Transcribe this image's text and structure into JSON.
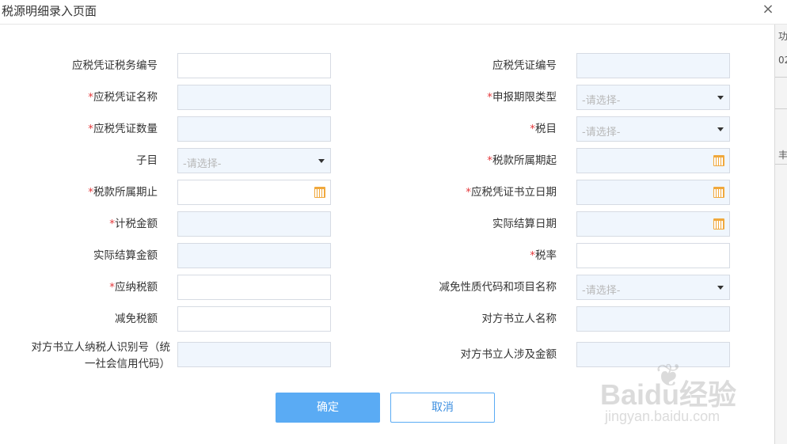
{
  "dialog": {
    "title": "税源明细录入页面",
    "close_glyph": "×"
  },
  "form": {
    "required_mark": "*",
    "left": [
      {
        "label": "应税凭证税务编号",
        "required": false,
        "type": "text",
        "value": ""
      },
      {
        "label": "应税凭证名称",
        "required": true,
        "type": "text-filled",
        "value": ""
      },
      {
        "label": "应税凭证数量",
        "required": true,
        "type": "text-filled",
        "value": ""
      },
      {
        "label": "子目",
        "required": false,
        "type": "select",
        "placeholder": "-请选择-"
      },
      {
        "label": "税款所属期止",
        "required": true,
        "type": "date",
        "value": ""
      },
      {
        "label": "计税金额",
        "required": true,
        "type": "text-filled",
        "value": ""
      },
      {
        "label": "实际结算金额",
        "required": false,
        "type": "text-filled",
        "value": ""
      },
      {
        "label": "应纳税额",
        "required": true,
        "type": "text",
        "value": ""
      },
      {
        "label": "减免税额",
        "required": false,
        "type": "text",
        "value": ""
      },
      {
        "label": "对方书立人纳税人识别号（统一社会信用代码）",
        "required": false,
        "type": "text-filled",
        "value": ""
      }
    ],
    "right": [
      {
        "label": "应税凭证编号",
        "required": false,
        "type": "text-filled",
        "value": ""
      },
      {
        "label": "申报期限类型",
        "required": true,
        "type": "select",
        "placeholder": "-请选择-"
      },
      {
        "label": "税目",
        "required": true,
        "type": "select",
        "placeholder": "-请选择-"
      },
      {
        "label": "税款所属期起",
        "required": true,
        "type": "date-filled",
        "value": ""
      },
      {
        "label": "应税凭证书立日期",
        "required": true,
        "type": "date-filled",
        "value": ""
      },
      {
        "label": "实际结算日期",
        "required": false,
        "type": "date-filled",
        "value": ""
      },
      {
        "label": "税率",
        "required": true,
        "type": "text",
        "value": ""
      },
      {
        "label": "减免性质代码和项目名称",
        "required": false,
        "type": "select",
        "placeholder": "-请选择-"
      },
      {
        "label": "对方书立人名称",
        "required": false,
        "type": "text-filled",
        "value": ""
      },
      {
        "label": "对方书立人涉及金额",
        "required": false,
        "type": "text-filled",
        "value": ""
      }
    ]
  },
  "buttons": {
    "confirm": "确定",
    "cancel": "取消"
  },
  "background_fragments": [
    "功",
    "02",
    "丰"
  ],
  "watermark": {
    "brand": "Baidu经验",
    "url": "jingyan.baidu.com"
  },
  "colors": {
    "accent": "#5aabf4",
    "required": "#e4393c",
    "filled_field": "#f0f6fd",
    "calendar_icon": "#f0a83c"
  }
}
